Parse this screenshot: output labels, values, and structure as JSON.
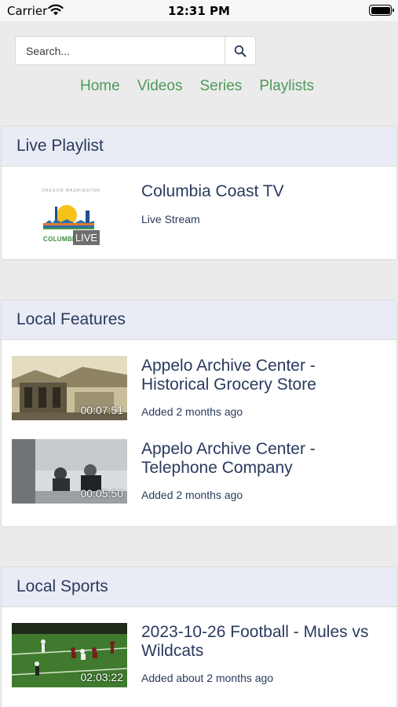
{
  "status_bar": {
    "carrier": "Carrier",
    "time": "12:31 PM"
  },
  "search": {
    "placeholder": "Search..."
  },
  "nav": {
    "items": [
      "Home",
      "Videos",
      "Series",
      "Playlists"
    ]
  },
  "sections": {
    "live": {
      "title": "Live Playlist",
      "items": [
        {
          "title": "Columbia Coast TV",
          "subtitle": "Live Stream",
          "badge": "LIVE",
          "logo_top_text": "OREGON  WASHINGTON",
          "logo_text": "COLUMBIA"
        }
      ]
    },
    "features": {
      "title": "Local Features",
      "items": [
        {
          "title": "Appelo Archive Center - Historical Grocery Store",
          "subtitle": "Added 2 months ago",
          "duration": "00:07:51"
        },
        {
          "title": "Appelo Archive Center - Telephone Company",
          "subtitle": "Added 2 months ago",
          "duration": "00:05:50"
        }
      ]
    },
    "sports": {
      "title": "Local Sports",
      "items": [
        {
          "title": "2023-10-26 Football - Mules vs Wildcats",
          "subtitle": "Added about 2 months ago",
          "duration": "02:03:22"
        }
      ]
    }
  },
  "colors": {
    "nav": "#4e9a5a",
    "text": "#2a3a5e",
    "header_bg": "#e9ecf5",
    "page_bg": "#ebebeb"
  }
}
